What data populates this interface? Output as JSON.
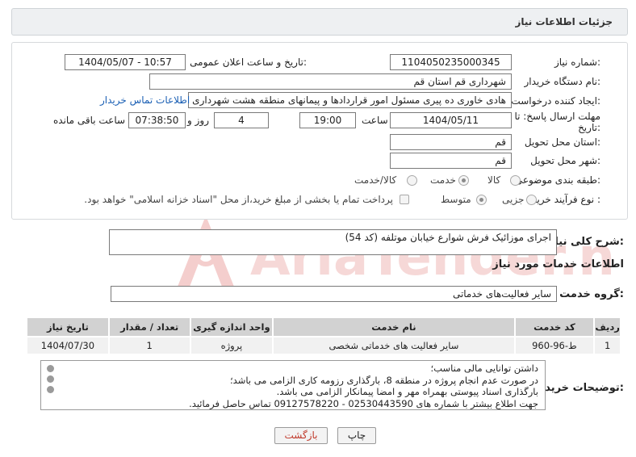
{
  "header": {
    "title": "جزئیات اطلاعات نیاز"
  },
  "form": {
    "need_number_label": "شماره نیاز:",
    "need_number": "1104050235000345",
    "announce_label": "تاریخ و ساعت اعلان عمومی:",
    "announce_value": "1404/05/07 - 10:57",
    "buyer_org_label": "نام دستگاه خریدار:",
    "buyer_org": "شهرداری قم استان قم",
    "creator_label": "ایجاد کننده درخواست:",
    "creator": "هادی خاوری ده پیری مسئول امور قراردادها و پیمانهای منطقه هشت شهرداری",
    "contact_link": "اطلاعات تماس خریدار",
    "deadline_label_1": "مهلت ارسال پاسخ: تا",
    "deadline_label_2": "تاریخ:",
    "deadline_date": "1404/05/11",
    "time_label": "ساعت",
    "deadline_time": "19:00",
    "days_value": "4",
    "days_label": "روز و",
    "remaining_time": "07:38:50",
    "remaining_label": "ساعت باقی مانده",
    "province_label": "استان محل تحویل:",
    "province": "قم",
    "city_label": "شهر محل تحویل:",
    "city": "قم",
    "category_label": "طبقه بندی موضوعی:",
    "category_options": [
      "کالا",
      "خدمت",
      "کالا/خدمت"
    ],
    "category_selected": "خدمت",
    "process_label": "نوع فرآیند خرید :",
    "process_options": [
      "جزیی",
      "متوسط"
    ],
    "process_selected": "جزیی",
    "payment_note": "پرداخت تمام یا بخشی از مبلغ خرید،از محل \"اسناد خزانه اسلامی\" خواهد بود."
  },
  "summary": {
    "label": "شرح کلی نیاز:",
    "text": "اجرای موزائیک فرش شوارع خیابان موتلفه (کد 54)"
  },
  "services": {
    "section_title": "اطلاعات خدمات مورد نیاز",
    "group_label": "گروه خدمت:",
    "group_value": "سایر فعالیت‌های خدماتی",
    "columns": [
      "ردیف",
      "کد خدمت",
      "نام خدمت",
      "واحد اندازه گیری",
      "تعداد / مقدار",
      "تاریخ نیاز"
    ],
    "rows": [
      [
        "1",
        "ط-96-960",
        "سایر فعالیت های خدماتی شخصی",
        "پروژه",
        "1",
        "1404/07/30"
      ]
    ]
  },
  "buyer_notes": {
    "label": "توضیحات خریدار:",
    "lines": [
      "داشتن توانایی مالی مناسب؛",
      "در صورت عدم انجام پروژه در منطقه 8، بارگذاری رزومه کاری الزامی می باشد؛",
      "بارگذاری اسناد پیوستی بهمراه مهر و امضا پیمانکار الزامی می باشد.",
      "جهت اطلاع بیشتر با شماره های 02530443590 - 09127578220 تماس حاصل فرمائید."
    ]
  },
  "buttons": {
    "print": "چاپ",
    "back": "بازگشت"
  },
  "watermark": {
    "text": "AriaTender.neT"
  },
  "colors": {
    "link": "#1a5fb4",
    "back_button_text": "#c0392b",
    "watermark": "#e8b4b4"
  }
}
